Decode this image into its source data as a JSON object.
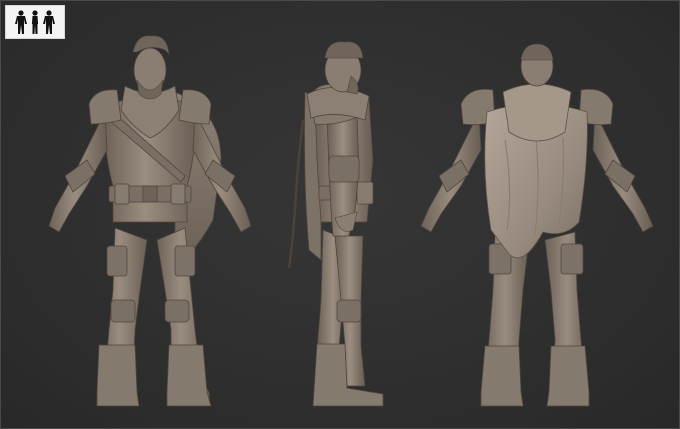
{
  "viewer": {
    "thumbnail_icon": "three-figures-silhouette-icon",
    "background_color": "#2f2f2f",
    "model_color": "#8c7f73",
    "model_shadow_color": "#5e544b",
    "model_highlight_color": "#a69a8e"
  },
  "views": [
    {
      "key": "front",
      "icon": "character-front-view"
    },
    {
      "key": "side",
      "icon": "character-side-view"
    },
    {
      "key": "back",
      "icon": "character-back-view"
    }
  ]
}
